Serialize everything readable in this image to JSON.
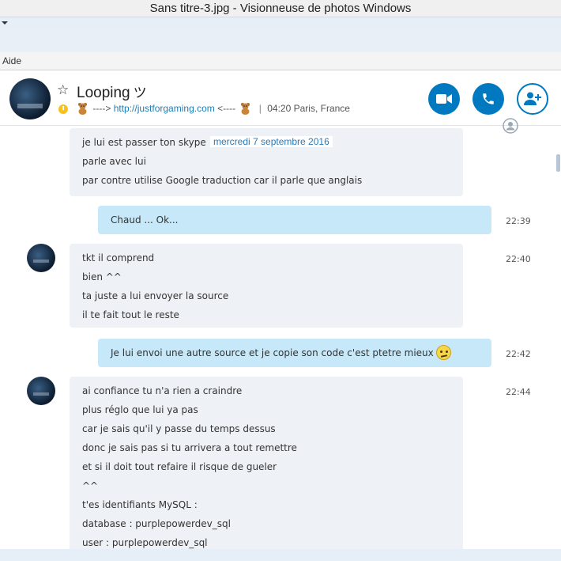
{
  "window_title": "Sans titre-3.jpg - Visionneuse de photos Windows",
  "menu": {
    "aide": "Aide"
  },
  "contact": {
    "name": "Looping",
    "name_symbol": "ツ",
    "mood_prefix": "---->",
    "mood_link": "http://justforgaming.com",
    "mood_suffix": "<----",
    "local_time": "04:20 Paris, France"
  },
  "date_separator": "mercredi 7 septembre 2016",
  "messages": [
    {
      "direction": "in",
      "lines": [
        "je lui est passer ton skype",
        "parle avec lui",
        "par contre utilise Google traduction car il parle que anglais"
      ]
    },
    {
      "direction": "out",
      "text": "Chaud ... Ok...",
      "time": "22:39"
    },
    {
      "direction": "in",
      "time": "22:40",
      "lines": [
        "tkt il comprend",
        "bien ^^",
        "ta juste a lui envoyer la source",
        "il te fait tout le reste"
      ]
    },
    {
      "direction": "out",
      "text": "Je lui envoi une autre source et je copie son code c'est ptetre mieux",
      "time": "22:42",
      "emoji": "confused-face-icon"
    },
    {
      "direction": "in",
      "time": "22:44",
      "lines": [
        "ai confiance tu n'a rien a craindre",
        "plus réglo que lui ya pas",
        "car je sais qu'il y passe du temps dessus",
        "donc je sais pas si tu arrivera a tout remettre",
        "et si il doit tout refaire il risque de gueler",
        "^^",
        "t'es identifiants MySQL :",
        "database : purplepowerdev_sql",
        "user : purplepowerdev_sql"
      ]
    }
  ],
  "colors": {
    "accent": "#0079c1",
    "outgoing_bubble": "#c7e8f8",
    "incoming_bubble": "#eef1f5",
    "status_away": "#f8c21c"
  }
}
